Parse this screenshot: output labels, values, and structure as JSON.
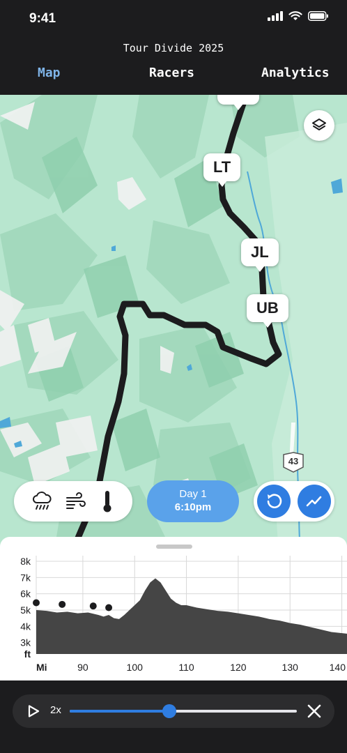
{
  "status": {
    "time": "9:41"
  },
  "header": {
    "title": "Tour Divide 2025",
    "tabs": [
      "Map",
      "Racers",
      "Analytics"
    ],
    "active_tab": "Map"
  },
  "map": {
    "markers": [
      {
        "label": "LT"
      },
      {
        "label": "JL"
      },
      {
        "label": "UB"
      }
    ],
    "highway_label": "43",
    "icons": [
      "layers-icon"
    ]
  },
  "weather": {
    "icons": [
      "rain-cloud-icon",
      "wind-icon",
      "thermometer-icon"
    ]
  },
  "day_pill": {
    "day": "Day 1",
    "time": "6:10pm"
  },
  "tools": {
    "icons": [
      "rewind-icon",
      "trend-icon"
    ]
  },
  "colors": {
    "accent": "#2f7de1",
    "day_pill": "#5aa2ea",
    "route": "#1c1c1e",
    "map_bg": "#b8e6cf",
    "tab_active": "#7fb4e8"
  },
  "chart_data": {
    "type": "area",
    "title": "",
    "xlabel": "Mi",
    "ylabel": "ft",
    "x_ticks": [
      90,
      100,
      110,
      120,
      130,
      140
    ],
    "y_ticks": [
      "8k",
      "7k",
      "6k",
      "5k",
      "4k",
      "3k"
    ],
    "xlim": [
      81,
      141
    ],
    "ylim": [
      2300,
      8000
    ],
    "grid": true,
    "series": [
      {
        "x": [
          81,
          83,
          85,
          87,
          89,
          91,
          93,
          94,
          95,
          96,
          97,
          98,
          99,
          100,
          101,
          102,
          103,
          104,
          105,
          106,
          107,
          108,
          109,
          110,
          112,
          114,
          116,
          118,
          120,
          122,
          124,
          126,
          128,
          130,
          132,
          134,
          136,
          138,
          141
        ],
        "y": [
          5000,
          4950,
          4850,
          4900,
          4800,
          4850,
          4700,
          4600,
          4700,
          4500,
          4450,
          4700,
          5000,
          5300,
          5600,
          6200,
          6700,
          6950,
          6700,
          6200,
          5700,
          5450,
          5300,
          5300,
          5150,
          5050,
          4950,
          4900,
          4800,
          4700,
          4600,
          4450,
          4350,
          4200,
          4100,
          3950,
          3800,
          3650,
          3550
        ]
      }
    ],
    "points": [
      {
        "x": 81,
        "y": 5450
      },
      {
        "x": 86,
        "y": 5350
      },
      {
        "x": 92,
        "y": 5250
      },
      {
        "x": 95,
        "y": 5150
      }
    ]
  },
  "player": {
    "speed": "2x",
    "progress": 0.44
  }
}
